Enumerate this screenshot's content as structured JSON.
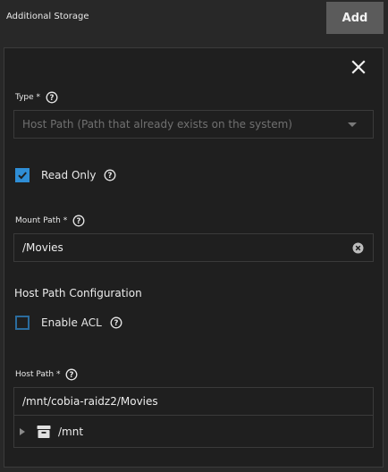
{
  "header": {
    "title": "Additional Storage",
    "add_label": "Add"
  },
  "form": {
    "type": {
      "label": "Type *",
      "value": "Host Path (Path that already exists on the system)"
    },
    "read_only": {
      "label": "Read Only",
      "checked": true
    },
    "mount_path": {
      "label": "Mount Path *",
      "value": "/Movies"
    },
    "host_path_config": {
      "title": "Host Path Configuration",
      "enable_acl": {
        "label": "Enable ACL",
        "checked": false
      },
      "host_path": {
        "label": "Host Path *",
        "value": "/mnt/cobia-raidz2/Movies"
      },
      "tree": {
        "node_label": "/mnt"
      }
    }
  },
  "icons": {
    "close": "close-icon",
    "help": "help-icon",
    "clear": "clear-icon",
    "folder": "archive-folder-icon",
    "dropdown": "dropdown-arrow-icon"
  },
  "colors": {
    "accent": "#2f8ed6",
    "background": "#282828",
    "panel": "#1f1f1f",
    "button": "#5b5b5b"
  }
}
